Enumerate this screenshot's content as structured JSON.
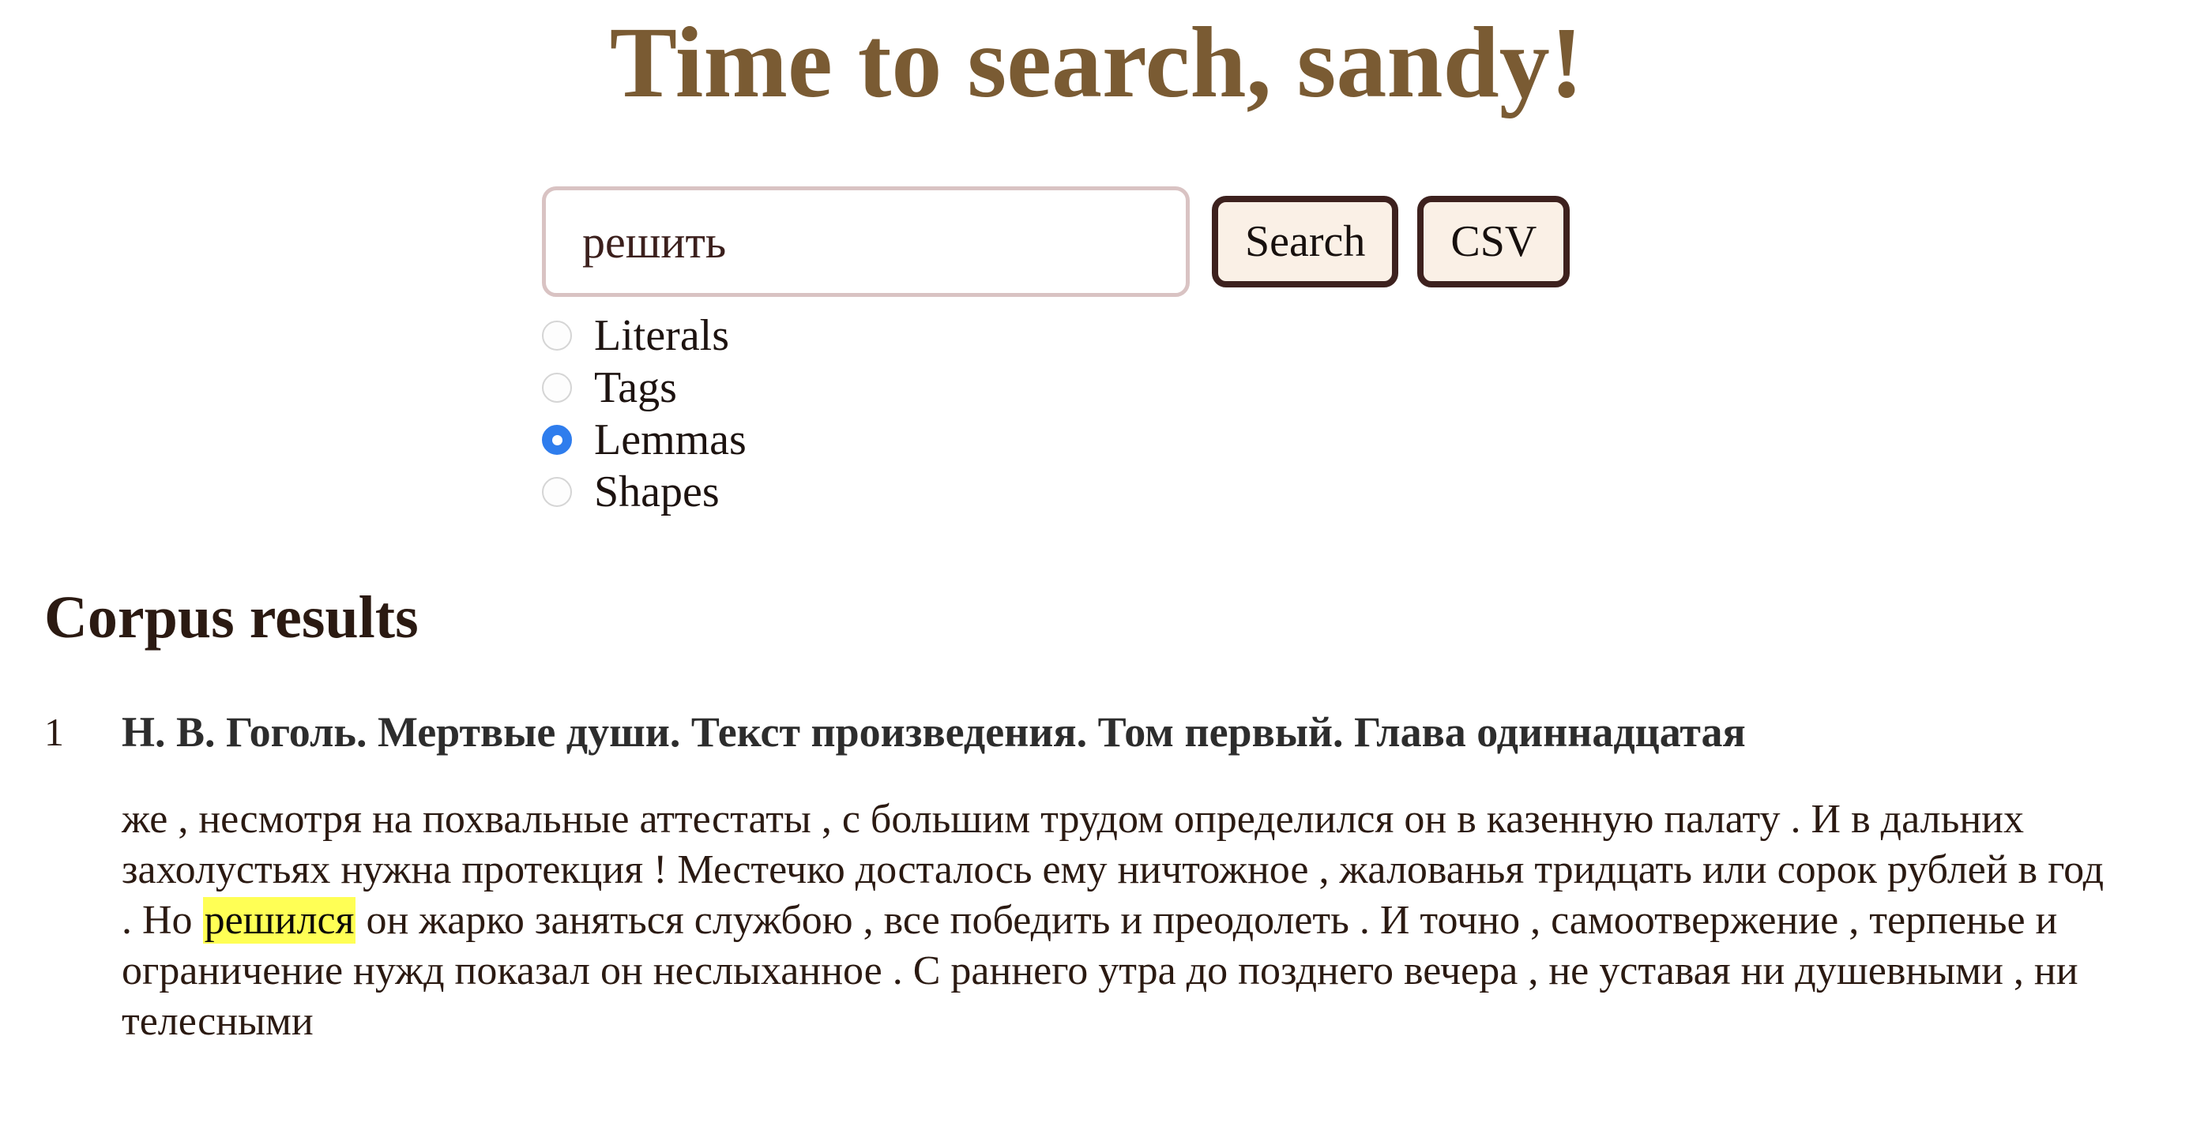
{
  "header": {
    "title": "Time to search, sandy!",
    "title_color": "#7a5b33"
  },
  "search": {
    "input_value": "решить",
    "input_placeholder": "",
    "search_button_label": "Search",
    "csv_button_label": "CSV",
    "button_bg": "#faf0e6",
    "button_border": "#3d211e",
    "input_border": "#d9c3c3"
  },
  "search_mode": {
    "selected": "Lemmas",
    "accent_color": "#2f7ded",
    "options": [
      {
        "label": "Literals",
        "checked": false
      },
      {
        "label": "Tags",
        "checked": false
      },
      {
        "label": "Lemmas",
        "checked": true
      },
      {
        "label": "Shapes",
        "checked": false
      }
    ]
  },
  "results": {
    "heading": "Corpus results",
    "items": [
      {
        "index": "1",
        "title": "Н. В. Гоголь. Мертвые души. Текст произведения. Том первый. Глава одиннадцатая",
        "snippet_before": "же , несмотря на похвальные аттестаты , с большим трудом определился он в казенную палату . И в дальних захолустьях нужна протекция ! Местечко досталось ему ничтожное , жалованья тридцать или сорок рублей в год . Но ",
        "keyword": "решился",
        "keyword_highlight": "#ffff55",
        "snippet_after": " он жарко заняться службою , все победить и преодолеть . И точно , самоотвержение , терпенье и ограничение нужд показал он неслыханное . С раннего утра до позднего вечера , не уставая ни душевными , ни телесными"
      }
    ]
  }
}
